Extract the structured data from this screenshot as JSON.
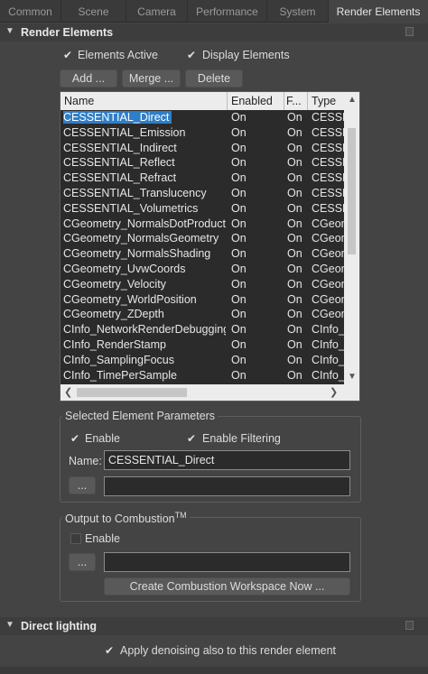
{
  "tabs": [
    "Common",
    "Scene",
    "Camera",
    "Performance",
    "System",
    "Render Elements"
  ],
  "render_elements": {
    "title": "Render Elements",
    "elements_active_label": "Elements Active",
    "display_elements_label": "Display Elements",
    "add_label": "Add ...",
    "merge_label": "Merge ...",
    "delete_label": "Delete",
    "columns": [
      "Name",
      "Enabled",
      "F...",
      "Type"
    ],
    "rows": [
      {
        "name": "CESSENTIAL_Direct",
        "enabled": "On",
        "f": "On",
        "type": "CESSEI"
      },
      {
        "name": "CESSENTIAL_Emission",
        "enabled": "On",
        "f": "On",
        "type": "CESSEI"
      },
      {
        "name": "CESSENTIAL_Indirect",
        "enabled": "On",
        "f": "On",
        "type": "CESSEI"
      },
      {
        "name": "CESSENTIAL_Reflect",
        "enabled": "On",
        "f": "On",
        "type": "CESSEI"
      },
      {
        "name": "CESSENTIAL_Refract",
        "enabled": "On",
        "f": "On",
        "type": "CESSEI"
      },
      {
        "name": "CESSENTIAL_Translucency",
        "enabled": "On",
        "f": "On",
        "type": "CESSEI"
      },
      {
        "name": "CESSENTIAL_Volumetrics",
        "enabled": "On",
        "f": "On",
        "type": "CESSEI"
      },
      {
        "name": "CGeometry_NormalsDotProduct",
        "enabled": "On",
        "f": "On",
        "type": "CGeom"
      },
      {
        "name": "CGeometry_NormalsGeometry",
        "enabled": "On",
        "f": "On",
        "type": "CGeom"
      },
      {
        "name": "CGeometry_NormalsShading",
        "enabled": "On",
        "f": "On",
        "type": "CGeom"
      },
      {
        "name": "CGeometry_UvwCoords",
        "enabled": "On",
        "f": "On",
        "type": "CGeom"
      },
      {
        "name": "CGeometry_Velocity",
        "enabled": "On",
        "f": "On",
        "type": "CGeom"
      },
      {
        "name": "CGeometry_WorldPosition",
        "enabled": "On",
        "f": "On",
        "type": "CGeom"
      },
      {
        "name": "CGeometry_ZDepth",
        "enabled": "On",
        "f": "On",
        "type": "CGeom"
      },
      {
        "name": "CInfo_NetworkRenderDebugging",
        "enabled": "On",
        "f": "On",
        "type": "CInfo_"
      },
      {
        "name": "CInfo_RenderStamp",
        "enabled": "On",
        "f": "On",
        "type": "CInfo_"
      },
      {
        "name": "CInfo_SamplingFocus",
        "enabled": "On",
        "f": "On",
        "type": "CInfo_"
      },
      {
        "name": "CInfo_TimePerSample",
        "enabled": "On",
        "f": "On",
        "type": "CInfo_"
      }
    ]
  },
  "selected_params": {
    "title": "Selected Element Parameters",
    "enable_label": "Enable",
    "enable_filtering_label": "Enable Filtering",
    "name_label": "Name:",
    "name_value": "CESSENTIAL_Direct",
    "browse_label": "...",
    "path_value": ""
  },
  "output_to": {
    "title": "Output to  Combustion",
    "title_sup": "TM",
    "enable_label": "Enable",
    "browse_label": "...",
    "path_value": "",
    "create_label": "Create Combustion Workspace Now ..."
  },
  "direct_lighting": {
    "title": "Direct lighting",
    "denoise_label": "Apply denoising also to this render element"
  }
}
